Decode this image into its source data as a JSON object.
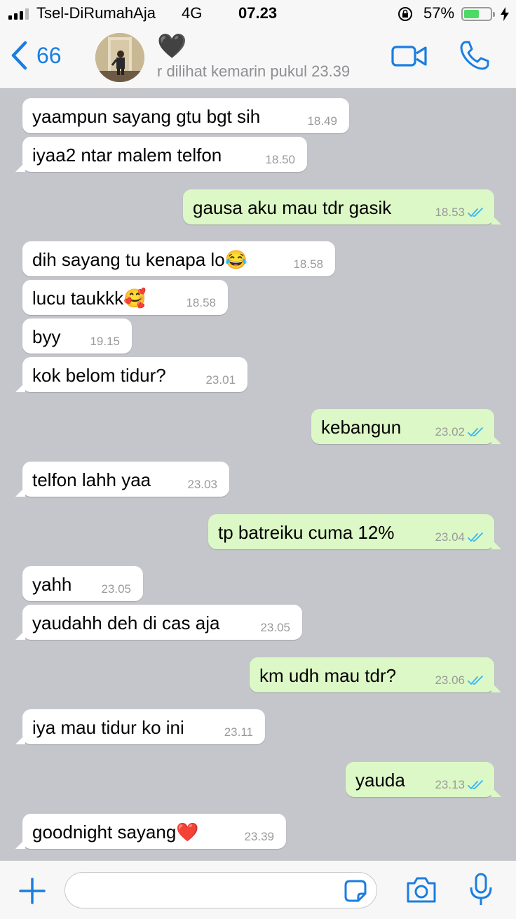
{
  "status_bar": {
    "carrier": "Tsel-DiRumahAja",
    "network": "4G",
    "time": "07.23",
    "battery_percent": "57%",
    "battery_level": 0.57
  },
  "header": {
    "back_count": "66",
    "contact_name": "🖤",
    "last_seen": "r dilihat kemarin pukul 23.39"
  },
  "colors": {
    "accent": "#1a7ee0",
    "outgoing_bubble": "#dcf8c6",
    "incoming_bubble": "#ffffff",
    "chat_background": "#c5c6cb",
    "read_ticks": "#34b7f1"
  },
  "icons": {
    "back": "chevron-left-icon",
    "video": "video-camera-icon",
    "call": "phone-icon",
    "attach": "plus-icon",
    "sticker": "sticker-icon",
    "camera": "camera-icon",
    "mic": "microphone-icon"
  },
  "messages": [
    {
      "dir": "in",
      "text": "yaampun sayang gtu bgt sih",
      "time": "18.49"
    },
    {
      "dir": "in",
      "text": "iyaa2 ntar malem telfon",
      "time": "18.50"
    },
    {
      "dir": "out",
      "text": "gausa aku mau tdr gasik",
      "time": "18.53",
      "status": "read"
    },
    {
      "dir": "in",
      "text": "dih sayang tu kenapa lo😂",
      "time": "18.58"
    },
    {
      "dir": "in",
      "text": "lucu taukkk🥰",
      "time": "18.58"
    },
    {
      "dir": "in",
      "text": "byy",
      "time": "19.15"
    },
    {
      "dir": "in",
      "text": "kok belom tidur?",
      "time": "23.01"
    },
    {
      "dir": "out",
      "text": "kebangun",
      "time": "23.02",
      "status": "read"
    },
    {
      "dir": "in",
      "text": "telfon lahh yaa",
      "time": "23.03"
    },
    {
      "dir": "out",
      "text": "tp batreiku cuma 12%",
      "time": "23.04",
      "status": "read"
    },
    {
      "dir": "in",
      "text": "yahh",
      "time": "23.05"
    },
    {
      "dir": "in",
      "text": "yaudahh deh di cas aja",
      "time": "23.05"
    },
    {
      "dir": "out",
      "text": "km udh mau tdr?",
      "time": "23.06",
      "status": "read"
    },
    {
      "dir": "in",
      "text": "iya mau tidur ko ini",
      "time": "23.11"
    },
    {
      "dir": "out",
      "text": "yauda",
      "time": "23.13",
      "status": "read"
    },
    {
      "dir": "in",
      "text": "goodnight sayang❤️",
      "time": "23.39"
    }
  ],
  "composer": {
    "value": "",
    "placeholder": ""
  }
}
